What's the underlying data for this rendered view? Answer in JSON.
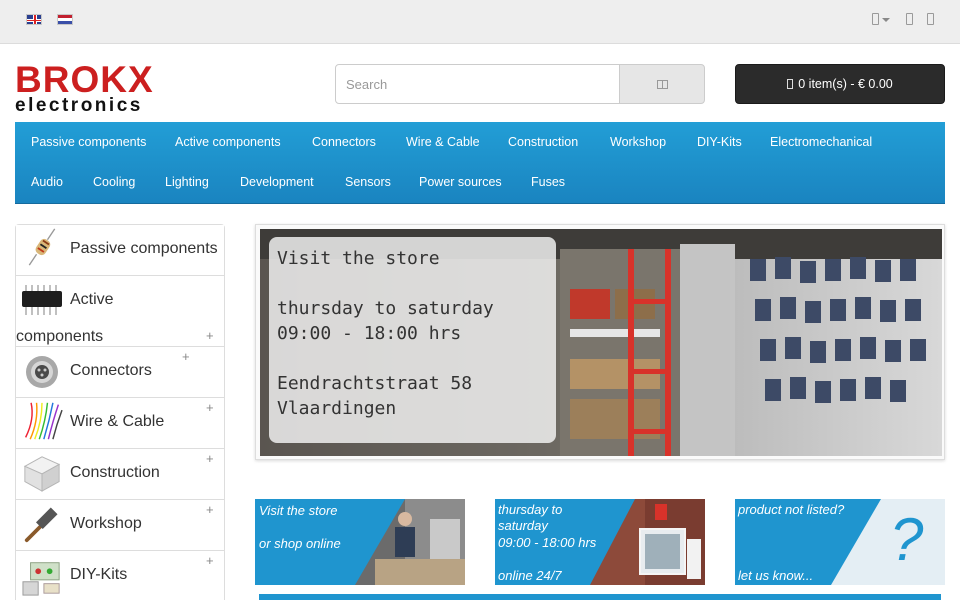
{
  "topbar": {
    "languages": [
      "English",
      "Nederlands"
    ],
    "icons": [
      "user-icon",
      "heart-icon",
      "cart-icon"
    ]
  },
  "logo": {
    "line1": "BROKX",
    "line2": "electronics"
  },
  "search": {
    "placeholder": "Search",
    "button_icon": "search-icon"
  },
  "cart": {
    "label": "0 item(s) - € 0.00"
  },
  "colors": {
    "nav": "#1f95cf",
    "cart_button": "#2b2b2b",
    "logo_red": "#cc1f1f",
    "promo_blue": "#1f95cf"
  },
  "nav": {
    "row1": [
      "Passive components",
      "Active components",
      "Connectors",
      "Wire & Cable",
      "Construction",
      "Workshop",
      "DIY-Kits",
      "Electromechanical"
    ],
    "row2": [
      "Audio",
      "Cooling",
      "Lighting",
      "Development",
      "Sensors",
      "Power sources",
      "Fuses"
    ]
  },
  "sidebar": {
    "items": [
      {
        "label": "Passive components",
        "expandable": false
      },
      {
        "label_line1": "Active",
        "label_line2": "components",
        "expandable": true
      },
      {
        "label": "Connectors",
        "expandable": true
      },
      {
        "label": "Wire & Cable",
        "expandable": true
      },
      {
        "label": "Construction",
        "expandable": true
      },
      {
        "label": "Workshop",
        "expandable": true
      },
      {
        "label": "DIY-Kits",
        "expandable": true
      }
    ],
    "expand_symbol": "+"
  },
  "banner": {
    "line1": "Visit the store",
    "line2": "thursday to saturday",
    "line3": "09:00 - 18:00 hrs",
    "line4": "Eendrachtstraat 58",
    "line5": "Vlaardingen"
  },
  "promos": [
    {
      "line1": "Visit the store",
      "line2": "or shop online"
    },
    {
      "line1": "thursday to",
      "line2": "saturday",
      "line3": "09:00 - 18:00 hrs",
      "line4": "online 24/7"
    },
    {
      "line1": "product not listed?",
      "line2": "let us know...",
      "symbol": "?"
    }
  ]
}
